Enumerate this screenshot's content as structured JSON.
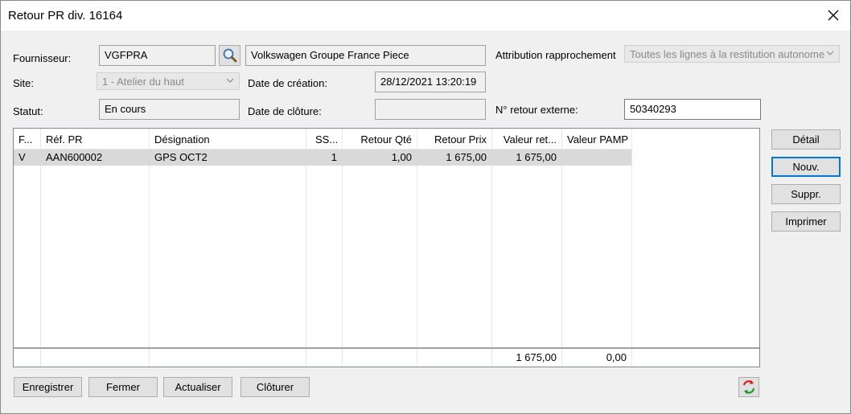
{
  "window": {
    "title": "Retour PR div. 16164"
  },
  "form": {
    "fournisseur_label": "Fournisseur:",
    "fournisseur_code": "VGFPRA",
    "fournisseur_name": "Volkswagen Groupe France Piece",
    "attribution_label": "Attribution rapprochement",
    "attribution_value": "Toutes les lignes à la restitution autonome",
    "site_label": "Site:",
    "site_value": "1 - Atelier du haut",
    "creation_label": "Date de création:",
    "creation_value": "28/12/2021 13:20:19",
    "statut_label": "Statut:",
    "statut_value": "En cours",
    "cloture_label": "Date de clôture:",
    "cloture_value": "",
    "retour_ext_label": "N° retour externe:",
    "retour_ext_value": "50340293"
  },
  "grid": {
    "columns": [
      "F...",
      "Réf. PR",
      "Désignation",
      "SS...",
      "Retour Qté",
      "Retour Prix",
      "Valeur ret...",
      "Valeur PAMP"
    ],
    "rows": [
      {
        "f": "V",
        "ref": "AAN600002",
        "designation": "GPS OCT2",
        "ss": "1",
        "qte": "1,00",
        "prix": "1 675,00",
        "valeur_ret": "1 675,00",
        "valeur_pamp": ""
      }
    ],
    "totals": {
      "valeur_ret": "1 675,00",
      "valeur_pamp": "0,00"
    }
  },
  "side_buttons": {
    "detail": "Détail",
    "nouv": "Nouv.",
    "suppr": "Suppr.",
    "imprimer": "Imprimer"
  },
  "bottom_buttons": {
    "enregistrer": "Enregistrer",
    "fermer": "Fermer",
    "actualiser": "Actualiser",
    "cloturer": "Clôturer"
  },
  "colors": {
    "focus": "#0078d7",
    "selected_row": "#d9d9d9"
  },
  "icons": {
    "close": "close-icon",
    "search": "magnifier-icon",
    "dropdown": "chevron-down-icon",
    "refresh": "refresh-icon"
  }
}
